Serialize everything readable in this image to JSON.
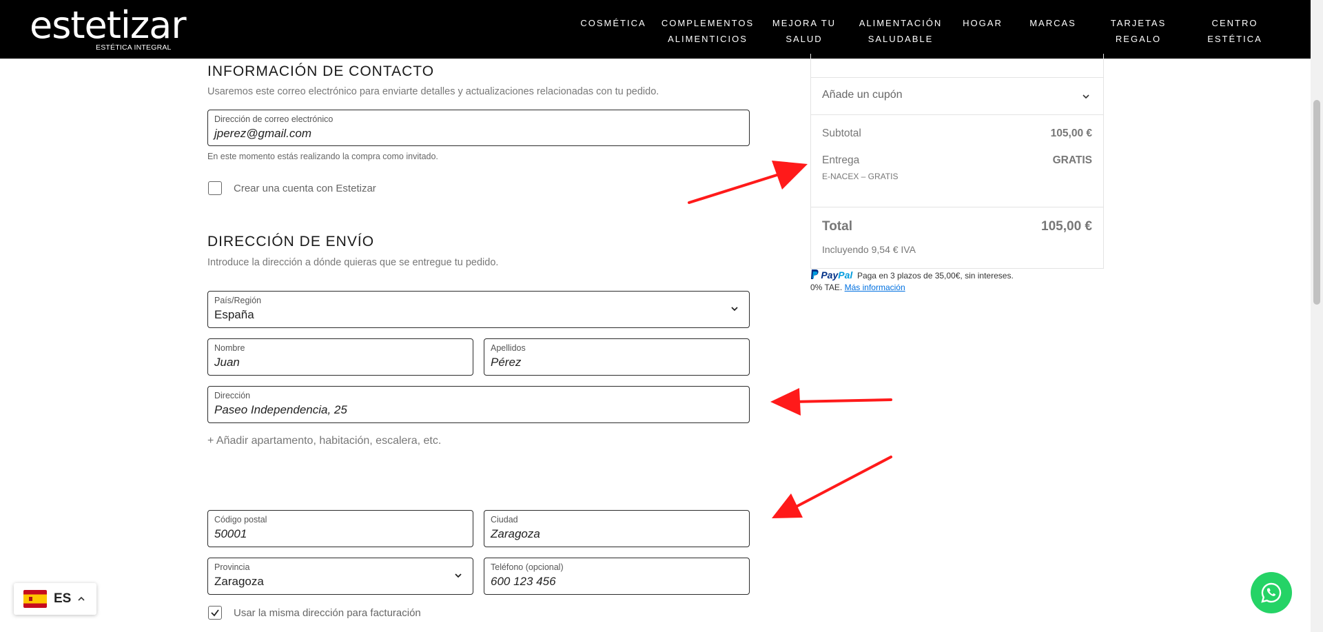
{
  "header": {
    "logo": "estetizar",
    "logo_sub": "ESTÉTICA INTEGRAL",
    "nav": [
      {
        "line1": "COSMÉTICA",
        "line2": ""
      },
      {
        "line1": "COMPLEMENTOS",
        "line2": "ALIMENTICIOS"
      },
      {
        "line1": "MEJORA TU",
        "line2": "SALUD"
      },
      {
        "line1": "ALIMENTACIÓN",
        "line2": "SALUDABLE"
      },
      {
        "line1": "HOGAR",
        "line2": ""
      },
      {
        "line1": "MARCAS",
        "line2": ""
      },
      {
        "line1": "TARJETAS",
        "line2": "REGALO"
      },
      {
        "line1": "CENTRO",
        "line2": "ESTÉTICA"
      }
    ]
  },
  "contact": {
    "title": "INFORMACIÓN DE CONTACTO",
    "description": "Usaremos este correo electrónico para enviarte detalles y actualizaciones relacionadas con tu pedido.",
    "email_label": "Dirección de correo electrónico",
    "email_value": "jperez@gmail.com",
    "guest_hint": "En este momento estás realizando la compra como invitado.",
    "create_account_label": "Crear una cuenta con Estetizar",
    "create_account_checked": false
  },
  "shipping": {
    "title": "DIRECCIÓN DE ENVÍO",
    "description": "Introduce la dirección a dónde quieras que se entregue tu pedido.",
    "country_label": "País/Región",
    "country_value": "España",
    "first_name_label": "Nombre",
    "first_name_value": "Juan",
    "last_name_label": "Apellidos",
    "last_name_value": "Pérez",
    "address_label": "Dirección",
    "address_value": "Paseo Independencia, 25",
    "add_apartment": "+ Añadir apartamento, habitación, escalera, etc.",
    "postcode_label": "Código postal",
    "postcode_value": "50001",
    "city_label": "Ciudad",
    "city_value": "Zaragoza",
    "province_label": "Provincia",
    "province_value": "Zaragoza",
    "phone_label": "Teléfono (opcional)",
    "phone_value": "600 123 456",
    "same_billing_label": "Usar la misma dirección para facturación",
    "same_billing_checked": true
  },
  "summary": {
    "coupon_label": "Añade un cupón",
    "subtotal_label": "Subtotal",
    "subtotal_value": "105,00 €",
    "shipping_label": "Entrega",
    "shipping_value": "GRATIS",
    "shipping_method": "E-NACEX – GRATIS",
    "total_label": "Total",
    "total_value": "105,00 €",
    "tax_note": "Incluyendo 9,54 € IVA"
  },
  "paypal": {
    "logo_part1": "Pay",
    "logo_part2": "Pal",
    "message_line1": "Paga en 3 plazos de 35,00€, sin intereses.",
    "message_line2": "0% TAE.",
    "link": "Más información"
  },
  "language": {
    "code": "ES"
  },
  "colors": {
    "header_bg": "#000000",
    "annotation_arrow": "#ff1a1a",
    "whatsapp": "#25d366"
  }
}
